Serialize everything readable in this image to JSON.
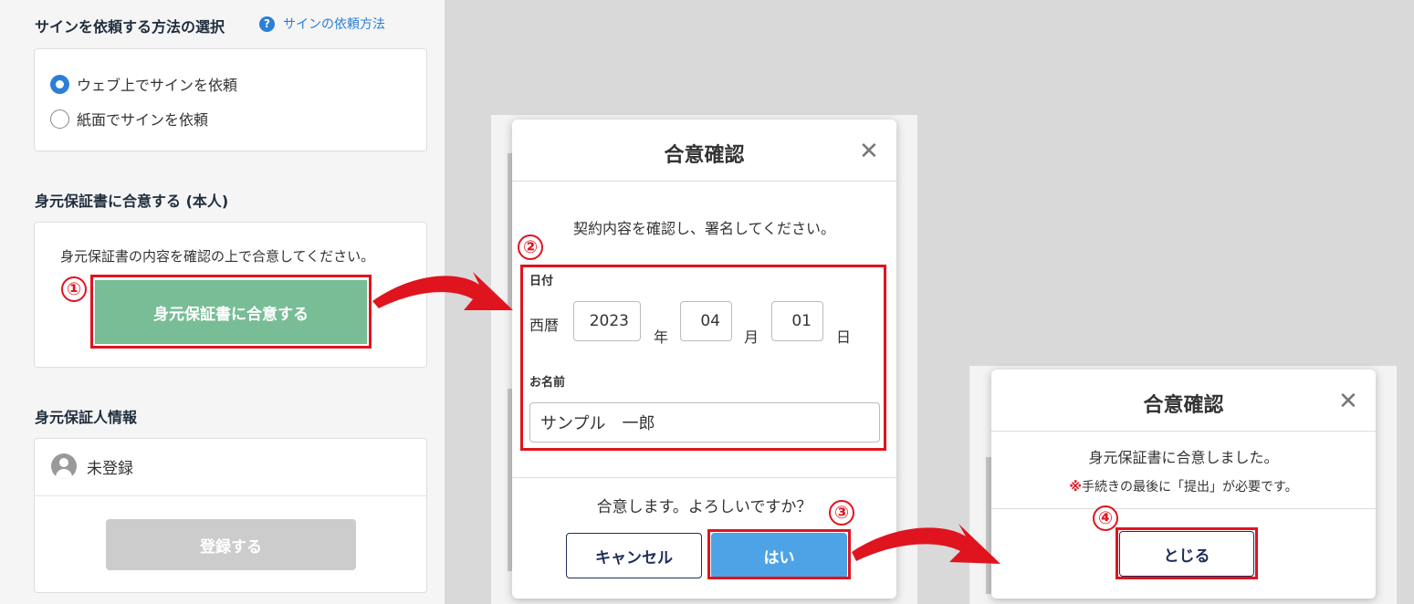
{
  "left": {
    "method_section": {
      "title": "サインを依頼する方法の選択",
      "help_link": "サインの依頼方法",
      "help_icon": "question-circle-icon",
      "options": [
        {
          "label": "ウェブ上でサインを依頼",
          "selected": true
        },
        {
          "label": "紙面でサインを依頼",
          "selected": false
        }
      ]
    },
    "agree_section": {
      "title": "身元保証書に合意する (本人)",
      "instruction": "身元保証書の内容を確認の上で合意してください。",
      "button": "身元保証書に合意する"
    },
    "guarantor_section": {
      "title": "身元保証人情報",
      "status": "未登録",
      "register_button": "登録する"
    }
  },
  "modal_confirm": {
    "title": "合意確認",
    "instruction": "契約内容を確認し、署名してください。",
    "date_label": "日付",
    "era": "西暦",
    "year": "2023",
    "year_unit": "年",
    "month": "04",
    "month_unit": "月",
    "day": "01",
    "day_unit": "日",
    "name_label": "お名前",
    "name_value": "サンプル　一郎",
    "question": "合意します。よろしいですか？",
    "cancel": "キャンセル",
    "yes": "はい"
  },
  "modal_done": {
    "title": "合意確認",
    "message": "身元保証書に合意しました。",
    "note_mark": "※",
    "note": "手続きの最後に「提出」が必要です。",
    "close": "とじる"
  },
  "steps": [
    "①",
    "②",
    "③",
    "④"
  ],
  "colors": {
    "accent_red": "#e0141e",
    "agree_green": "#78bd96",
    "yes_blue": "#4ea3e6",
    "link_blue": "#2b7fd6",
    "navy": "#1f2d5a"
  }
}
